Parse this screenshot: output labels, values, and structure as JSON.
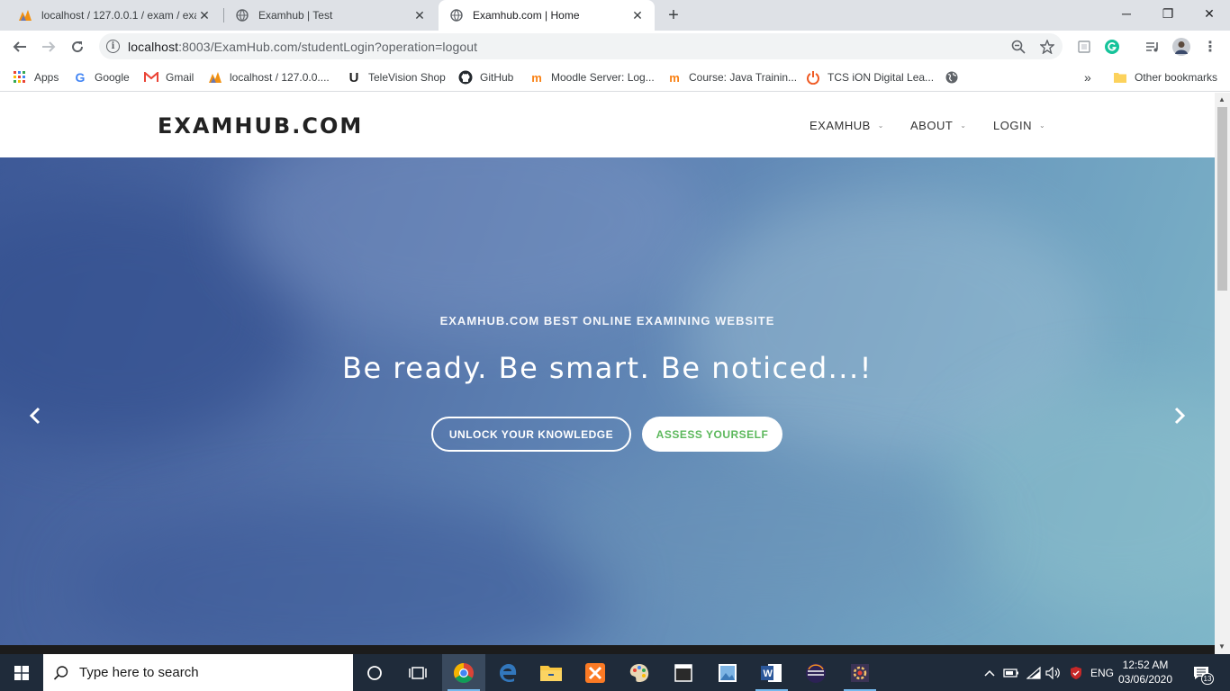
{
  "browser": {
    "tabs": [
      {
        "title": "localhost / 127.0.0.1 / exam / exa",
        "icon": "phpmyadmin-icon",
        "active": false
      },
      {
        "title": "Examhub | Test",
        "icon": "globe-icon",
        "active": false
      },
      {
        "title": "Examhub.com | Home",
        "icon": "globe-icon",
        "active": true
      }
    ],
    "new_tab": "+",
    "window_controls": {
      "minimize": "─",
      "restore": "❐",
      "close": "✕"
    },
    "url": {
      "host": "localhost",
      "rest": ":8003/ExamHub.com/studentLogin?operation=logout"
    },
    "bookmarks": [
      {
        "label": "Apps",
        "icon": "apps-grid-icon"
      },
      {
        "label": "Google",
        "icon": "google-icon"
      },
      {
        "label": "Gmail",
        "icon": "gmail-icon"
      },
      {
        "label": "localhost / 127.0.0....",
        "icon": "phpmyadmin-icon"
      },
      {
        "label": "TeleVision Shop",
        "icon": "u-icon"
      },
      {
        "label": "GitHub",
        "icon": "github-icon"
      },
      {
        "label": "Moodle Server: Log...",
        "icon": "moodle-icon"
      },
      {
        "label": "Course: Java Trainin...",
        "icon": "moodle-icon"
      },
      {
        "label": "TCS iON Digital Lea...",
        "icon": "power-icon"
      },
      {
        "label": "",
        "icon": "globe-icon"
      }
    ],
    "bookmarks_more": "»",
    "other_bookmarks": "Other bookmarks"
  },
  "site": {
    "logo": "EXAMHUB.COM",
    "menu": [
      "EXAMHUB",
      "ABOUT",
      "LOGIN"
    ],
    "hero": {
      "subtitle": "EXAMHUB.COM BEST ONLINE EXAMINING WEBSITE",
      "title": "Be ready. Be smart. Be noticed...!",
      "btn_primary": "UNLOCK YOUR KNOWLEDGE",
      "btn_secondary": "ASSESS YOURSELF"
    }
  },
  "taskbar": {
    "search_placeholder": "Type here to search",
    "language": "ENG",
    "time": "12:52 AM",
    "date": "03/06/2020",
    "notifications": "13"
  },
  "colors": {
    "accent_green": "#5cb85c",
    "hero_blue": "#4f6ca5",
    "taskbar": "#1f2b3a"
  }
}
